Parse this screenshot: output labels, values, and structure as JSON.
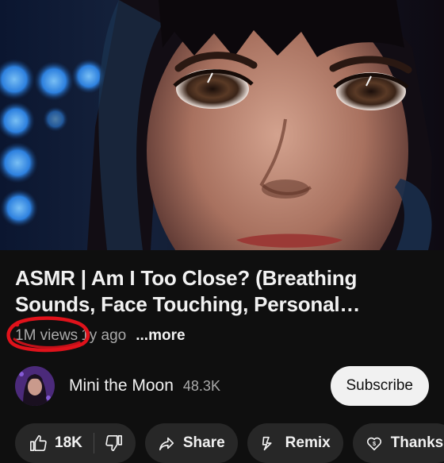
{
  "video": {
    "title": "ASMR | Am I Too Close? (Breathing Sounds, Face Touching, Personal Attention)",
    "views": "1M views",
    "age": "1y ago",
    "more_label": "...more"
  },
  "channel": {
    "name": "Mini the Moon",
    "subscribers": "48.3K",
    "subscribe_label": "Subscribe"
  },
  "actions": {
    "likes": "18K",
    "share_label": "Share",
    "remix_label": "Remix",
    "thanks_label": "Thanks"
  },
  "icons": {
    "like": "thumbs-up-icon",
    "dislike": "thumbs-down-icon",
    "share": "share-icon",
    "remix": "remix-icon",
    "thanks": "thanks-icon"
  },
  "colors": {
    "background": "#0f0f0f",
    "chip": "#272727",
    "annotation": "#e0121b"
  }
}
